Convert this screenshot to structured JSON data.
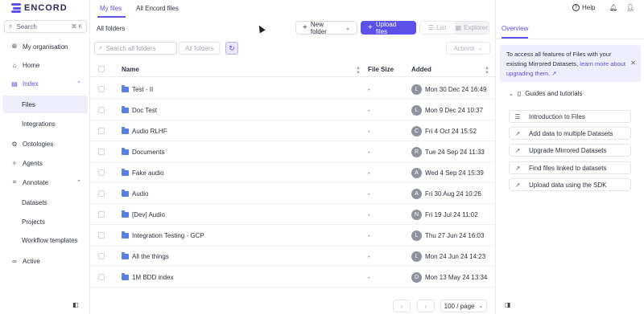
{
  "app": {
    "brand": "ENCORD"
  },
  "sidebar": {
    "search_label": "Search",
    "search_shortcut": "⌘ K",
    "items": [
      {
        "label": "My organisation",
        "icon": "globe-icon"
      },
      {
        "label": "Home",
        "icon": "home-icon"
      },
      {
        "label": "Index",
        "icon": "index-icon"
      },
      {
        "label": "Files"
      },
      {
        "label": "Integrations"
      },
      {
        "label": "Ontologies",
        "icon": "ontology-icon"
      },
      {
        "label": "Agents",
        "icon": "agents-icon"
      },
      {
        "label": "Annotate",
        "icon": "annotate-icon"
      },
      {
        "label": "Datasets"
      },
      {
        "label": "Projects"
      },
      {
        "label": "Workflow templates"
      },
      {
        "label": "Active",
        "icon": "active-icon"
      }
    ]
  },
  "header": {
    "help_label": "Help"
  },
  "main": {
    "tabs": [
      "My files",
      "All Encord files"
    ],
    "breadcrumb": "All folders",
    "new_folder_label": "New folder",
    "upload_label": "Upload files",
    "view_list_label": "List",
    "view_explorer_label": "Explorer",
    "search_placeholder": "Search all folders",
    "scope_label": "All folders",
    "actions_label": "Actions",
    "columns": {
      "name": "Name",
      "size": "File Size",
      "added": "Added"
    },
    "rows": [
      {
        "name": "Test - II",
        "size": "-",
        "initial": "L",
        "added": "Mon 30 Dec 24 16:49"
      },
      {
        "name": "Doc Test",
        "size": "-",
        "initial": "L",
        "added": "Mon 9 Dec 24 10:37"
      },
      {
        "name": "Audio RLHF",
        "size": "-",
        "initial": "C",
        "added": "Fri 4 Oct 24 15:52"
      },
      {
        "name": "Documents",
        "size": "-",
        "initial": "R",
        "added": "Tue 24 Sep 24 11:33"
      },
      {
        "name": "Fake audio",
        "size": "-",
        "initial": "A",
        "added": "Wed 4 Sep 24 15:39"
      },
      {
        "name": "Audio",
        "size": "-",
        "initial": "A",
        "added": "Fri 30 Aug 24 10:26"
      },
      {
        "name": "[Dev] Audio",
        "size": "-",
        "initial": "N",
        "added": "Fri 19 Jul 24 11:02"
      },
      {
        "name": "Integration Testing - GCP",
        "size": "-",
        "initial": "L",
        "added": "Thu 27 Jun 24 16:03"
      },
      {
        "name": "All the things",
        "size": "-",
        "initial": "L",
        "added": "Mon 24 Jun 24 14:23"
      },
      {
        "name": "1M BDD index",
        "size": "-",
        "initial": "D",
        "added": "Mon 13 May 24 13:34"
      }
    ],
    "page_size_label": "100 / page"
  },
  "panel": {
    "tab_label": "Overview",
    "notice_text": "To access all features of Files with your existing Mirrored Datasets, ",
    "notice_link": "learn more about upgrading them.",
    "guides_title": "Guides and tutorials",
    "guides": [
      {
        "label": "Introduction to Files",
        "icon": "list-icon"
      },
      {
        "label": "Add data to multiple Datasets",
        "icon": "external-link-icon"
      },
      {
        "label": "Upgrade Mirrored Datasets",
        "icon": "external-link-icon"
      },
      {
        "label": "Find files linked to datasets",
        "icon": "external-link-icon"
      },
      {
        "label": "Upload data using the SDK",
        "icon": "external-link-icon"
      }
    ]
  },
  "colors": {
    "accent": "#5b50e8",
    "notice_bg": "#efeefc",
    "folder": "#5b7fe0"
  }
}
